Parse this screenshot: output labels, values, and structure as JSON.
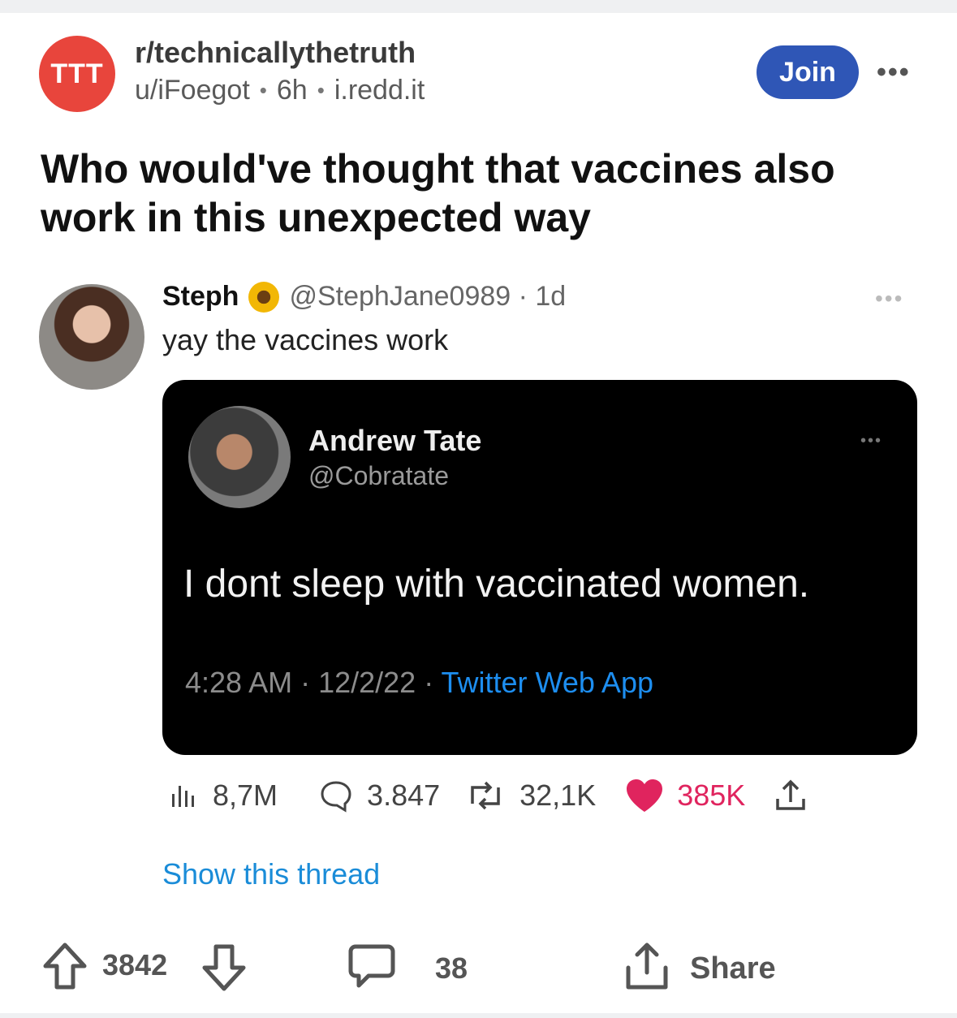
{
  "subreddit": {
    "avatar_text": "TTT",
    "name": "r/technicallythetruth",
    "author": "u/iFoegot",
    "age": "6h",
    "domain": "i.redd.it",
    "join_label": "Join",
    "more": "•••"
  },
  "post": {
    "title": "Who would've thought that vaccines also work in this unexpected way"
  },
  "tweet": {
    "name": "Steph",
    "handle_age": "@StephJane0989 · 1d",
    "more": "•••",
    "text": "yay the vaccines work",
    "embedded": {
      "name": "Andrew Tate",
      "handle": "@Cobratate",
      "more": "•••",
      "text": "I dont sleep with vaccinated women.",
      "timestamp": "4:28 AM · 12/2/22 · ",
      "app": "Twitter Web App"
    },
    "stats": {
      "views": "8,7M",
      "replies": "3.847",
      "retweets": "32,1K",
      "likes": "385K"
    },
    "show_thread": "Show this thread"
  },
  "footer": {
    "score": "3842",
    "comments": "38",
    "share_label": "Share"
  },
  "colors": {
    "reddit_red": "#e8453c",
    "join_blue": "#2f56b6",
    "twitter_blue": "#1a8cd8",
    "like_pink": "#e0245e"
  }
}
